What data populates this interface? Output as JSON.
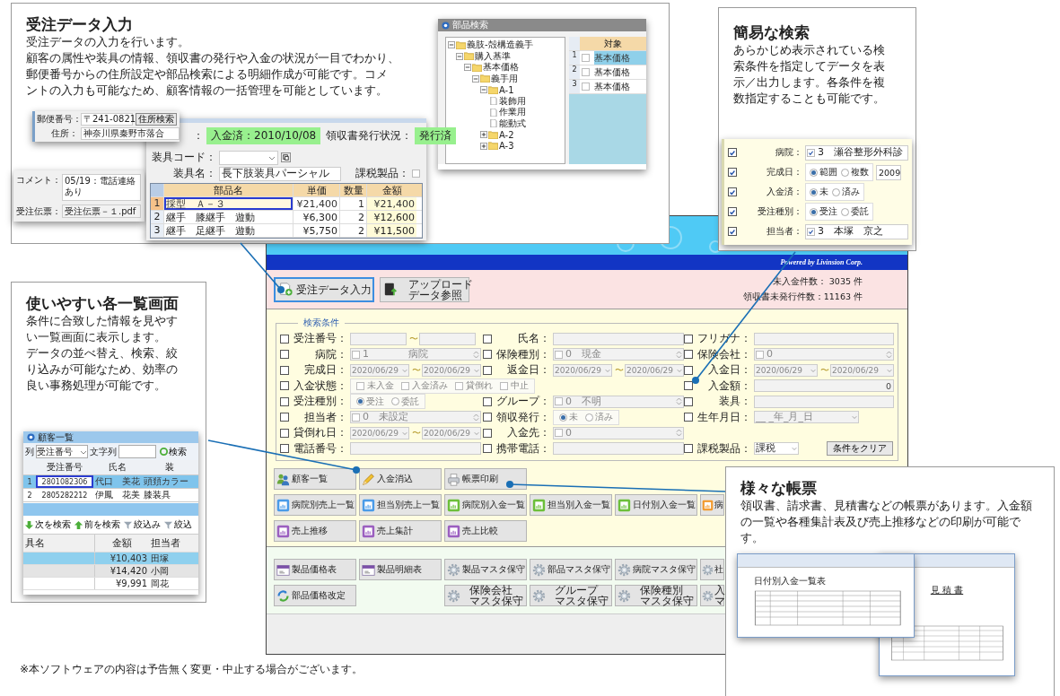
{
  "app": {
    "header": {
      "credit": "Powered by Livinsion Corp."
    },
    "toolbar": {
      "buttons": [
        {
          "lines": [
            "受注データ入力"
          ],
          "kind": "document",
          "focused": true
        },
        {
          "lines": [
            "アップロード",
            "データ参照"
          ],
          "kind": "upload",
          "focused": false
        }
      ],
      "stats": [
        "未入金件数： 3035 件",
        "領収書未発行件数：11163 件"
      ]
    },
    "search": {
      "legend": "検索条件",
      "columns": [
        [
          {
            "label": "受注番号：",
            "checked": false,
            "kind": "range",
            "separator": "〜"
          },
          {
            "label": "病院：",
            "checked": false,
            "kind": "select",
            "value": "1　　　　病院",
            "value_checked": false
          },
          {
            "label": "完成日：",
            "checked": false,
            "kind": "date_range",
            "from": "2020/06/29",
            "to": "2020/06/29",
            "separator": "〜"
          },
          {
            "label": "入金状態：",
            "checked": false,
            "kind": "checkgroup",
            "options": [
              {
                "label": "未入金",
                "checked": false
              },
              {
                "label": "入金済み",
                "checked": false
              },
              {
                "label": "貸倒れ",
                "checked": false
              },
              {
                "label": "中止",
                "checked": false
              }
            ]
          },
          {
            "label": "受注種別：",
            "checked": false,
            "kind": "radio",
            "options": [
              {
                "label": "受注",
                "selected": true
              },
              {
                "label": "委託",
                "selected": false
              }
            ]
          },
          {
            "label": "担当者：",
            "checked": false,
            "kind": "select",
            "value": "0　未設定",
            "value_checked": false
          },
          {
            "label": "貸倒れ日：",
            "checked": false,
            "kind": "date_range",
            "from": "2020/06/29",
            "to": "2020/06/29",
            "separator": "〜"
          },
          {
            "label": "電話番号：",
            "checked": false,
            "kind": "text"
          }
        ],
        [
          {
            "label": "氏名：",
            "checked": false,
            "kind": "text"
          },
          {
            "label": "保険種別：",
            "checked": false,
            "kind": "select",
            "value": "0　現金",
            "value_checked": false
          },
          {
            "label": "返金日：",
            "checked": false,
            "kind": "date_range",
            "from": "2020/06/29",
            "to": "2020/06/29",
            "separator": "〜"
          },
          {
            "kind": "blank"
          },
          {
            "label": "グループ：",
            "checked": false,
            "kind": "select",
            "value": "0　不明",
            "value_checked": false
          },
          {
            "label": "領収発行：",
            "checked": false,
            "kind": "radio",
            "options": [
              {
                "label": "未",
                "selected": true
              },
              {
                "label": "済み",
                "selected": false
              }
            ]
          },
          {
            "label": "入金先：",
            "checked": false,
            "kind": "select",
            "value": "0",
            "value_checked": false
          },
          {
            "label": "携帯電話：",
            "checked": false,
            "kind": "text"
          }
        ],
        [
          {
            "label": "フリガナ：",
            "checked": false,
            "kind": "text"
          },
          {
            "label": "保険会社：",
            "checked": false,
            "kind": "select",
            "value": "0",
            "value_checked": false
          },
          {
            "label": "入金日：",
            "checked": false,
            "kind": "date_range",
            "from": "2020/06/29",
            "to": "2020/06/29",
            "separator": "〜"
          },
          {
            "label": "入金額：",
            "checked": false,
            "kind": "number",
            "value": "0"
          },
          {
            "label": "装具：",
            "checked": false,
            "kind": "text"
          },
          {
            "label": "生年月日：",
            "checked": false,
            "kind": "date",
            "value": "__ _年_月_日"
          },
          {
            "kind": "blank"
          },
          {
            "label": "課税製品：",
            "checked": false,
            "kind": "select_button",
            "value": "課税",
            "button": "条件をクリア"
          }
        ]
      ]
    },
    "menu_rows": [
      [
        {
          "lines": [
            "顧客一覧"
          ],
          "kind": "people"
        },
        {
          "lines": [
            "入金消込"
          ],
          "kind": "pencil"
        },
        {
          "lines": [
            "帳票印刷"
          ],
          "kind": "printer"
        }
      ],
      [
        {
          "lines": [
            "病院別売上一覧"
          ],
          "kind": "chart",
          "color": "#4a9be8"
        },
        {
          "lines": [
            "担当別売上一覧"
          ],
          "kind": "chart",
          "color": "#4a9be8"
        },
        {
          "lines": [
            "病院別入金一覧"
          ],
          "kind": "chart",
          "color": "#6cbf3a"
        },
        {
          "lines": [
            "担当別入金一覧"
          ],
          "kind": "chart",
          "color": "#6cbf3a"
        },
        {
          "lines": [
            "日付別入金一覧"
          ],
          "kind": "chart",
          "color": "#6cbf3a"
        },
        {
          "lines": [
            "病"
          ],
          "kind": "chart",
          "color": "#f29a2e"
        }
      ],
      [
        {
          "lines": [
            "売上推移"
          ],
          "kind": "chart",
          "color": "#9b5fc0"
        },
        {
          "lines": [
            "売上集計"
          ],
          "kind": "chart",
          "color": "#9b5fc0"
        },
        {
          "lines": [
            "売上比較"
          ],
          "kind": "chart",
          "color": "#9b5fc0"
        }
      ]
    ],
    "master_rows": [
      [
        {
          "lines": [
            "製品価格表"
          ],
          "kind": "calendar"
        },
        {
          "lines": [
            "製品明細表"
          ],
          "kind": "calendar"
        },
        {
          "lines": [
            "製品マスタ保守"
          ],
          "kind": "gear"
        },
        {
          "lines": [
            "部品マスタ保守"
          ],
          "kind": "gear"
        },
        {
          "lines": [
            "病院マスタ保守"
          ],
          "kind": "gear"
        },
        {
          "lines": [
            "社"
          ],
          "kind": "gear"
        }
      ],
      [
        {
          "lines": [
            "部品価格改定"
          ],
          "kind": "refresh"
        },
        {
          "kind": "gap"
        },
        {
          "lines": [
            "保険会社",
            "マスタ保守"
          ],
          "kind": "gear"
        },
        {
          "lines": [
            "グループ",
            "マスタ保守"
          ],
          "kind": "gear"
        },
        {
          "lines": [
            "保険種別",
            "マスタ保守"
          ],
          "kind": "gear"
        },
        {
          "lines": [
            "入",
            "マ"
          ],
          "kind": "gear"
        }
      ]
    ]
  },
  "order_entry_card": {
    "title": "受注データ入力",
    "text_lines": [
      "受注データの入力を行います。",
      "顧客の属性や装具の情報、領収書の発行や入金の状況が一目でわかり、",
      "郵便番号からの住所設定や部品検索による明細作成が可能です。コメ",
      "ントの入力も可能なため、顧客情報の一括管理を可能としています。"
    ],
    "postal": {
      "label": "郵便番号：",
      "value": "〒241-0821",
      "button": "住所検索",
      "address_label": "住所：",
      "address": "神奈川県秦野市落合"
    },
    "comment": {
      "label": "コメント：",
      "value": "05/19：電話連絡あり",
      "slip_label": "受注伝票：",
      "slip": "受注伝票－１.pdf"
    },
    "detail": {
      "cut_label": "：",
      "paid": "入金済：2010/10/08",
      "receipt_label": "領収書発行状況：",
      "receipt": "発行済",
      "code_label": "装具コード：",
      "name_label": "装具名：",
      "name": "長下肢装具パーシャル",
      "tax_label": "課税製品：",
      "tax_checked": false,
      "columns": [
        "部品名",
        "単価",
        "数量",
        "金額"
      ],
      "rows": [
        {
          "no": "1",
          "cells": [
            "採型　Ａ－３",
            "¥21,400",
            "1",
            "¥21,400"
          ],
          "selected": true
        },
        {
          "no": "2",
          "cells": [
            "継手　膝継手　遊動",
            "¥6,300",
            "2",
            "¥12,600"
          ],
          "selected": false
        },
        {
          "no": "3",
          "cells": [
            "継手　足継手　遊動",
            "¥5,750",
            "2",
            "¥11,500"
          ],
          "selected": false
        }
      ]
    },
    "parts_window": {
      "title": "部品検索",
      "tree": [
        {
          "label": "義肢-殻構造義手",
          "expanded": true,
          "children": [
            {
              "label": "購入基準",
              "expanded": true,
              "children": [
                {
                  "label": "基本価格",
                  "expanded": true,
                  "children": [
                    {
                      "label": "義手用",
                      "expanded": true,
                      "children": [
                        {
                          "label": "A-1",
                          "expanded": true,
                          "children": [
                            {
                              "label": "装飾用"
                            },
                            {
                              "label": "作業用"
                            },
                            {
                              "label": "能動式"
                            }
                          ]
                        },
                        {
                          "label": "A-2",
                          "expanded": false
                        },
                        {
                          "label": "A-3",
                          "expanded": false
                        }
                      ]
                    }
                  ]
                }
              ]
            }
          ]
        }
      ],
      "column": "対象",
      "rows": [
        {
          "no": "1",
          "checked": false,
          "label": "基本価格",
          "selected": true
        },
        {
          "no": "2",
          "checked": false,
          "label": "基本価格",
          "selected": false
        },
        {
          "no": "3",
          "checked": false,
          "label": "基本価格",
          "selected": false
        }
      ]
    }
  },
  "search_card": {
    "title": "簡易な検索",
    "text_lines": [
      "あらかじめ表示されている検",
      "索条件を指定してデータを表",
      "示／出力します。各条件を複",
      "数指定することも可能です。"
    ],
    "rows": [
      {
        "label": "病院：",
        "checked": true,
        "kind": "select",
        "value": "3　瀬谷整形外科診",
        "value_checked": true
      },
      {
        "label": "完成日：",
        "checked": true,
        "kind": "radio",
        "options": [
          {
            "label": "範囲",
            "selected": true
          },
          {
            "label": "複数",
            "selected": false
          }
        ],
        "extra": "2009"
      },
      {
        "label": "入金済：",
        "checked": true,
        "kind": "radio",
        "options": [
          {
            "label": "未",
            "selected": true
          },
          {
            "label": "済み",
            "selected": false
          }
        ]
      },
      {
        "label": "受注種別：",
        "checked": true,
        "kind": "radio",
        "options": [
          {
            "label": "受注",
            "selected": true
          },
          {
            "label": "委託",
            "selected": false
          }
        ]
      },
      {
        "label": "担当者：",
        "checked": true,
        "kind": "select",
        "value": "3　本塚　京之",
        "value_checked": true
      }
    ]
  },
  "list_card": {
    "title": "使いやすい各一覧画面",
    "text_lines": [
      "条件に合致した情報を見やす",
      "い一覧画面に表示します。",
      "データの並べ替え、検索、絞",
      "り込みが可能なため、効率の",
      "良い事務処理が可能です。"
    ],
    "window": {
      "title": "顧客一覧",
      "column_label": "列",
      "column_value": "受注番号",
      "text_label": "文字列",
      "search_button": "検索",
      "columns": [
        "受注番号",
        "氏名",
        "装"
      ],
      "rows": [
        {
          "no": "1",
          "cells": [
            "2801082306",
            "代口　美花",
            "頭頚カラー"
          ],
          "selected": true
        },
        {
          "no": "2",
          "cells": [
            "2805282212",
            "伊鳳　花美",
            "膝装具"
          ],
          "selected": false
        }
      ]
    },
    "zoom": {
      "buttons": [
        {
          "label": "次を検索",
          "kind": "down"
        },
        {
          "label": "前を検索",
          "kind": "up"
        },
        {
          "label": "絞込み",
          "kind": "filter"
        },
        {
          "label": "絞込",
          "kind": "filter"
        }
      ],
      "columns": [
        "具名",
        "金額",
        "担当者"
      ],
      "rows": [
        {
          "amount": "¥10,403",
          "person": "田塚",
          "selected": true
        },
        {
          "amount": "¥14,420",
          "person": "小岡",
          "selected": false
        },
        {
          "amount": "¥9,991",
          "person": "岡花",
          "selected": false
        }
      ]
    }
  },
  "report_card": {
    "title": "様々な帳票",
    "text_lines": [
      "領収書、請求書、見積書などの帳票があります。入金額",
      "の一覧や各種集計表及び売上推移などの印刷が可能です。"
    ],
    "reports": [
      {
        "heading": "日付別入金一覧表"
      },
      {
        "heading": "見 積 書"
      }
    ]
  },
  "footer_note": "※本ソフトウェアの内容は予告無く変更・中止する場合がございます。"
}
